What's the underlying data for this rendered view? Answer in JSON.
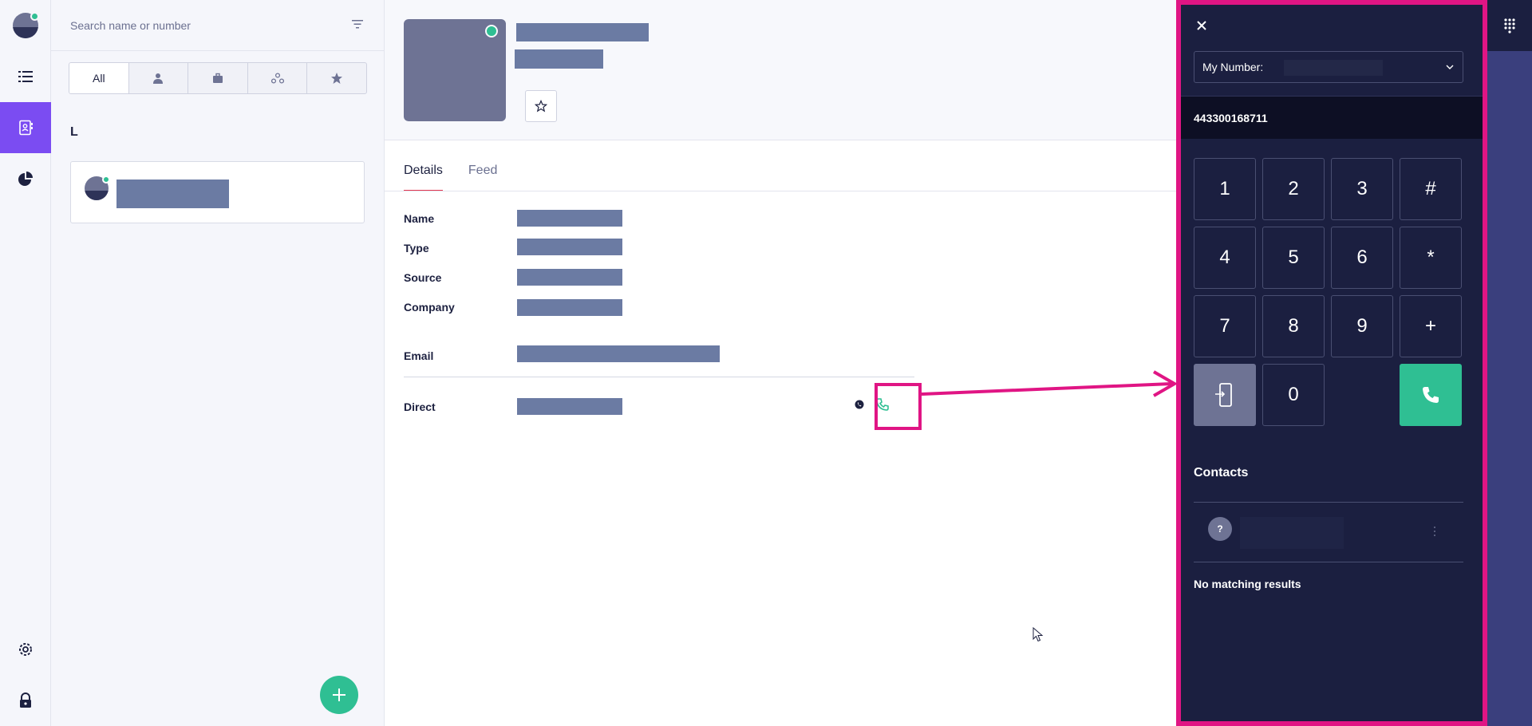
{
  "nav": {
    "items": [
      "contacts-list-icon",
      "address-book-icon",
      "analytics-icon",
      "settings-icon",
      "lock-icon"
    ],
    "active": "address-book-icon"
  },
  "search": {
    "placeholder": "Search name or number"
  },
  "filters": {
    "tabs": [
      {
        "label": "All",
        "icon": ""
      },
      {
        "label": "",
        "icon": "person-icon"
      },
      {
        "label": "",
        "icon": "briefcase-icon"
      },
      {
        "label": "",
        "icon": "group-icon"
      },
      {
        "label": "",
        "icon": "star-icon"
      }
    ],
    "active": "All"
  },
  "contacts": {
    "section_letter": "L"
  },
  "detail": {
    "tabs": [
      "Details",
      "Feed"
    ],
    "active_tab": "Details",
    "fields": [
      "Name",
      "Type",
      "Source",
      "Company",
      "Email",
      "Direct"
    ]
  },
  "dialer": {
    "my_number_label": "My Number:",
    "dialed_number": "443300168711",
    "keys": [
      "1",
      "2",
      "3",
      "#",
      "4",
      "5",
      "6",
      "*",
      "7",
      "8",
      "9",
      "+",
      "",
      "0",
      "",
      ""
    ],
    "contacts_title": "Contacts",
    "result_initial": "?",
    "no_results": "No matching results"
  },
  "colors": {
    "accent": "#7b4cf2",
    "online": "#2fbf93",
    "call": "#2fbf93",
    "dialer_bg": "#1b1f40",
    "highlight": "#e01584",
    "redaction": "#6b7ba3"
  }
}
